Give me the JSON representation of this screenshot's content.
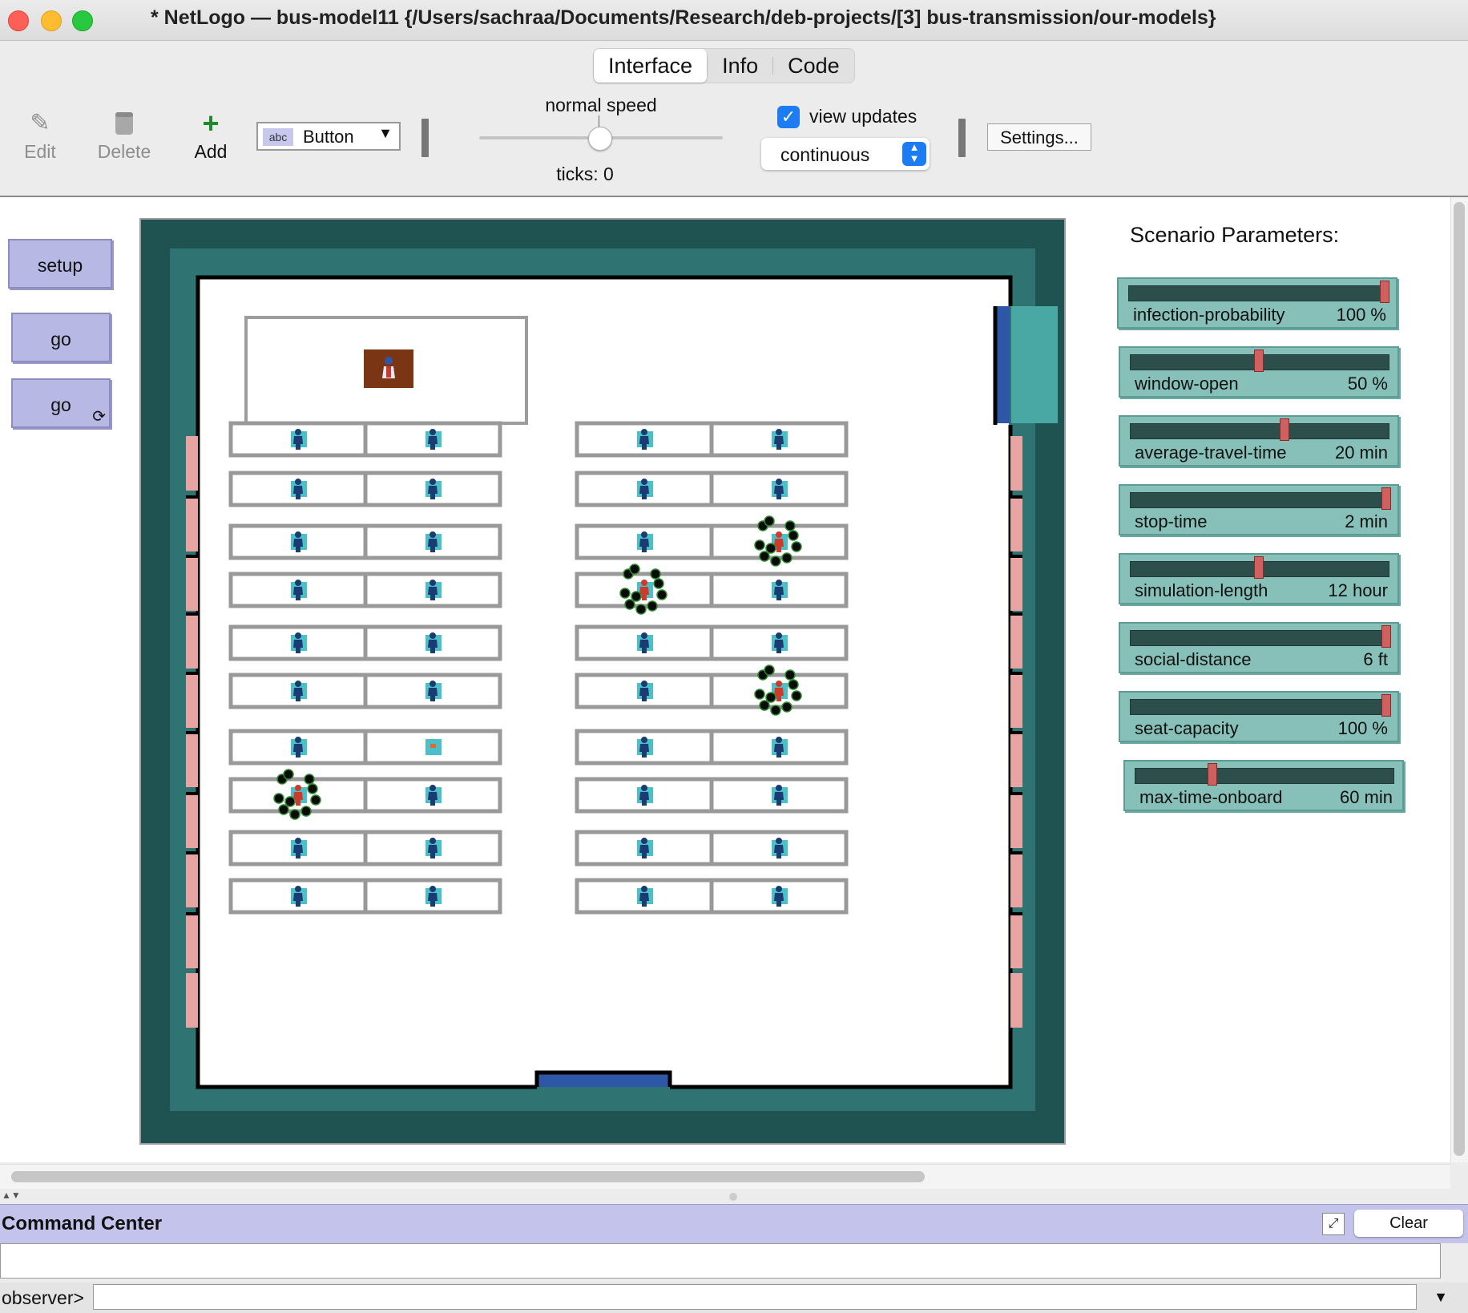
{
  "window": {
    "title": "* NetLogo — bus-model11 {/Users/sachraa/Documents/Research/deb-projects/[3] bus-transmission/our-models}"
  },
  "tabs": [
    {
      "label": "Interface",
      "active": true
    },
    {
      "label": "Info",
      "active": false
    },
    {
      "label": "Code",
      "active": false
    }
  ],
  "toolbar": {
    "edit_label": "Edit",
    "delete_label": "Delete",
    "add_label": "Add",
    "widget_type": "Button",
    "widget_icon_text": "abc",
    "speed_label": "normal speed",
    "speed_value": 0.5,
    "ticks_label": "ticks: 0",
    "view_updates_label": "view updates",
    "view_updates_checked": true,
    "update_mode": "continuous",
    "settings_label": "Settings..."
  },
  "buttons": {
    "setup": "setup",
    "go": "go",
    "go_forever": "go"
  },
  "parameters": {
    "title": "Scenario Parameters:",
    "sliders": [
      {
        "name": "infection-probability",
        "value": "100 %",
        "fraction": 1.0
      },
      {
        "name": "window-open",
        "value": "50 %",
        "fraction": 0.5
      },
      {
        "name": "average-travel-time",
        "value": "20 min",
        "fraction": 0.6
      },
      {
        "name": "stop-time",
        "value": "2 min",
        "fraction": 1.0
      },
      {
        "name": "simulation-length",
        "value": "12 hour",
        "fraction": 0.5
      },
      {
        "name": "social-distance",
        "value": "6 ft",
        "fraction": 1.0
      },
      {
        "name": "seat-capacity",
        "value": "100 %",
        "fraction": 1.0
      },
      {
        "name": "max-time-onboard",
        "value": "60 min",
        "fraction": 0.3
      }
    ]
  },
  "world": {
    "colors": {
      "outer": "#1f5352",
      "inner": "#2f7472",
      "wall": "#000000",
      "window": "#e8a3a3",
      "door": "#2f57a7",
      "seat": "#4cc0c8",
      "person": "#1b3b73",
      "infected": "#d03a2a",
      "driver_seat": "#7a3514"
    },
    "infected_seats": [
      {
        "side": "right",
        "row": 2,
        "seat": 1
      },
      {
        "side": "right",
        "row": 3,
        "seat": 0
      },
      {
        "side": "right",
        "row": 5,
        "seat": 1
      },
      {
        "side": "left",
        "row": 7,
        "seat": 0
      }
    ],
    "empty_seats": [
      {
        "side": "left",
        "row": 6,
        "seat": 1
      }
    ]
  },
  "command_center": {
    "title": "Command Center",
    "clear_label": "Clear",
    "prompt": "observer>"
  }
}
